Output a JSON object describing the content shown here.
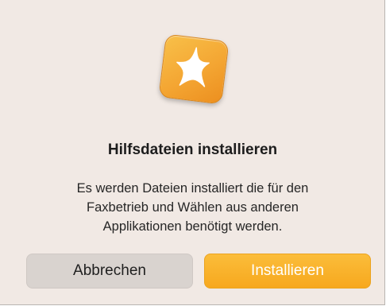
{
  "dialog": {
    "title": "Hilfsdateien installieren",
    "message": "Es werden Dateien installiert die für den Faxbetrieb und Wählen aus anderen Applikationen benötigt werden.",
    "icon": "app-star-icon",
    "accent_color": "#f7a81e"
  },
  "buttons": {
    "cancel_label": "Abbrechen",
    "install_label": "Installieren"
  }
}
